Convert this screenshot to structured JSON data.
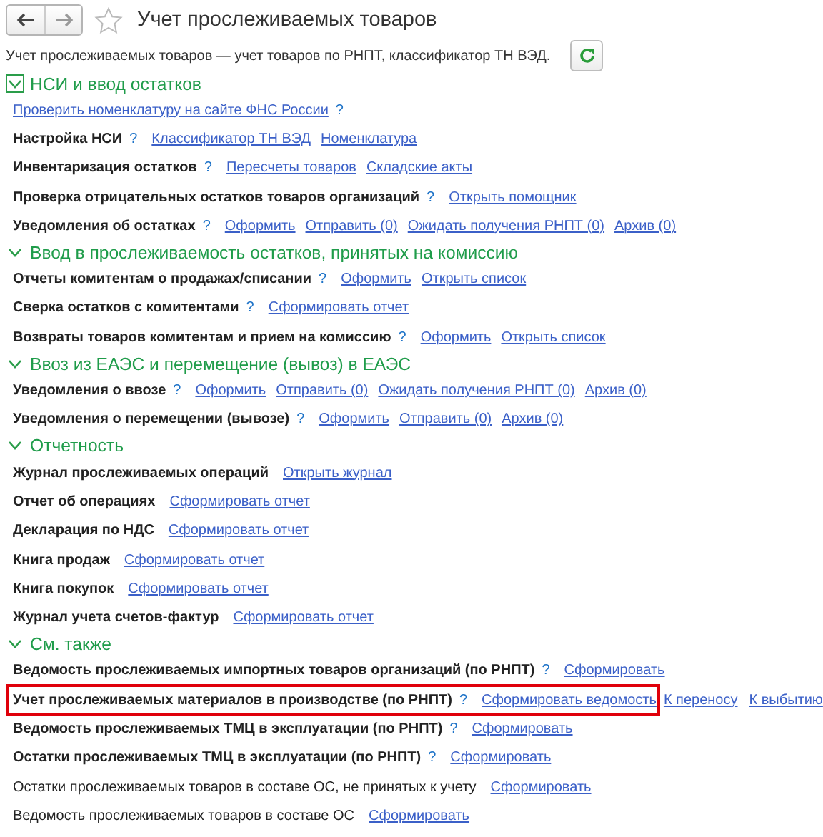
{
  "title": "Учет прослеживаемых товаров",
  "favorite": false,
  "description": "Учет прослеживаемых товаров — учет товаров по РНПТ, классификатор ТН ВЭД.",
  "sections": [
    {
      "title": "НСИ и ввод остатков",
      "expanded": true,
      "focused": true,
      "rows": [
        {
          "kind": "link",
          "links": [
            "Проверить номенклатуру на сайте ФНС России"
          ],
          "help": "?"
        },
        {
          "kind": "setting",
          "label": "Настройка НСИ",
          "bold": true,
          "help": "?",
          "links": [
            "Классификатор ТН ВЭД",
            "Номенклатура"
          ],
          "highlighted": false
        },
        {
          "kind": "setting",
          "label": "Инвентаризация остатков",
          "bold": true,
          "help": "?",
          "links": [
            "Пересчеты товаров",
            "Складские акты"
          ],
          "highlighted": false
        },
        {
          "kind": "setting",
          "label": "Проверка отрицательных остатков товаров организаций",
          "bold": true,
          "help": "?",
          "links": [
            "Открыть помощник"
          ],
          "highlighted": false
        },
        {
          "kind": "setting",
          "label": "Уведомления об остатках",
          "bold": true,
          "help": "?",
          "links": [
            "Оформить",
            "Отправить (0)",
            "Ожидать получения РНПТ (0)",
            "Архив (0)"
          ],
          "highlighted": false
        }
      ]
    },
    {
      "title": "Ввод в прослеживаемость остатков, принятых на комиссию",
      "expanded": true,
      "focused": false,
      "rows": [
        {
          "kind": "setting",
          "label": "Отчеты комитентам о продажах/списании",
          "bold": true,
          "help": "?",
          "links": [
            "Оформить",
            "Открыть список"
          ],
          "highlighted": false
        },
        {
          "kind": "setting",
          "label": "Сверка остатков с комитентами",
          "bold": true,
          "help": "?",
          "links": [
            "Сформировать отчет"
          ],
          "highlighted": false
        },
        {
          "kind": "setting",
          "label": "Возвраты товаров комитентам и прием на комиссию",
          "bold": true,
          "help": "?",
          "links": [
            "Оформить",
            "Открыть список"
          ],
          "highlighted": false
        }
      ]
    },
    {
      "title": "Ввоз из ЕАЭС и перемещение (вывоз) в ЕАЭС",
      "expanded": true,
      "focused": false,
      "rows": [
        {
          "kind": "setting",
          "label": "Уведомления о ввозе",
          "bold": true,
          "help": "?",
          "links": [
            "Оформить",
            "Отправить (0)",
            "Ожидать получения РНПТ (0)",
            "Архив (0)"
          ],
          "highlighted": false
        },
        {
          "kind": "setting",
          "label": "Уведомления о перемещении (вывозе)",
          "bold": true,
          "help": "?",
          "links": [
            "Оформить",
            "Отправить (0)",
            "Архив (0)"
          ],
          "highlighted": false
        }
      ]
    },
    {
      "title": "Отчетность",
      "expanded": true,
      "focused": false,
      "rows": [
        {
          "kind": "setting",
          "label": "Журнал прослеживаемых операций",
          "bold": true,
          "links": [
            "Открыть журнал"
          ],
          "highlighted": false
        },
        {
          "kind": "setting",
          "label": "Отчет об операциях",
          "bold": true,
          "links": [
            "Сформировать отчет"
          ],
          "highlighted": false
        },
        {
          "kind": "setting",
          "label": "Декларация по НДС",
          "bold": true,
          "links": [
            "Сформировать отчет"
          ],
          "highlighted": false
        },
        {
          "kind": "setting",
          "label": "Книга продаж",
          "bold": true,
          "links": [
            "Сформировать отчет"
          ],
          "highlighted": false
        },
        {
          "kind": "setting",
          "label": "Книга покупок",
          "bold": true,
          "links": [
            "Сформировать отчет"
          ],
          "highlighted": false
        },
        {
          "kind": "setting",
          "label": "Журнал учета счетов-фактур",
          "bold": true,
          "links": [
            "Сформировать отчет"
          ],
          "highlighted": false
        }
      ]
    },
    {
      "title": "См. также",
      "expanded": true,
      "focused": false,
      "rows": [
        {
          "kind": "setting",
          "label": "Ведомость прослеживаемых импортных товаров организаций (по РНПТ)",
          "bold": true,
          "help": "?",
          "links": [
            "Сформировать"
          ],
          "highlighted": false
        },
        {
          "kind": "setting",
          "label": "Учет прослеживаемых материалов в производстве (по РНПТ)",
          "bold": true,
          "help": "?",
          "links": [
            "Сформировать ведомость"
          ],
          "extra_links": [
            "К переносу",
            "К выбытию"
          ],
          "highlighted": true
        },
        {
          "kind": "setting",
          "label": "Ведомость прослеживаемых ТМЦ в эксплуатации (по РНПТ)",
          "bold": true,
          "help": "?",
          "links": [
            "Сформировать"
          ],
          "highlighted": false
        },
        {
          "kind": "setting",
          "label": "Остатки прослеживаемых ТМЦ в эксплуатации (по РНПТ)",
          "bold": true,
          "help": "?",
          "links": [
            "Сформировать"
          ],
          "highlighted": false
        },
        {
          "kind": "setting",
          "label": "Остатки прослеживаемых товаров в составе ОС, не принятых к учету",
          "bold": false,
          "links": [
            "Сформировать"
          ],
          "highlighted": false
        },
        {
          "kind": "setting",
          "label": "Ведомость прослеживаемых товаров в составе ОС",
          "bold": false,
          "links": [
            "Сформировать"
          ],
          "highlighted": false
        }
      ]
    }
  ]
}
